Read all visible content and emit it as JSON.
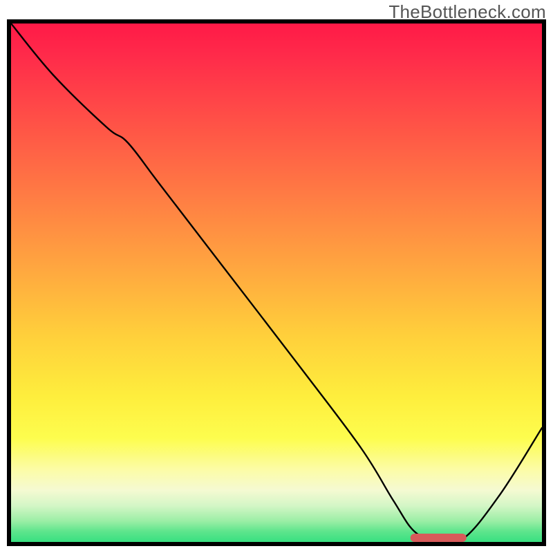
{
  "watermark": "TheBottleneck.com",
  "chart_data": {
    "type": "line",
    "title": "",
    "xlabel": "",
    "ylabel": "",
    "xlim": [
      0,
      100
    ],
    "ylim": [
      0,
      100
    ],
    "grid": false,
    "series": [
      {
        "name": "curve",
        "x": [
          0,
          8,
          18,
          22,
          28,
          40,
          55,
          66,
          72,
          76,
          80,
          85,
          92,
          100
        ],
        "values": [
          100,
          90,
          80,
          77,
          69,
          53,
          33,
          18,
          8,
          2,
          0.5,
          0.5,
          9,
          22
        ],
        "color": "#000000"
      }
    ],
    "marker": {
      "x_start": 76,
      "x_end": 85,
      "y": 0.8,
      "color": "#d85a5a"
    },
    "background_gradient": {
      "top_color": "#ff1a47",
      "mid_upper_color": "#ffcf3b",
      "mid_lower_color": "#fdfd4e",
      "bottom_color": "#38e081"
    }
  }
}
